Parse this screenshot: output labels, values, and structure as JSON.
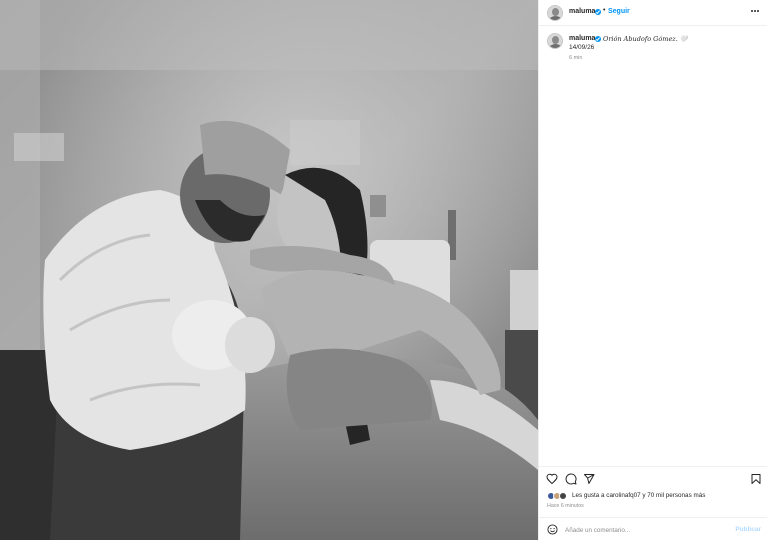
{
  "post": {
    "username": "maluma",
    "follow_label": "Seguir",
    "separator": "•",
    "photo_alt": "Foto en blanco y negro",
    "caption": {
      "username": "maluma",
      "text": "Orión Abudofo Gómez. 🤍",
      "date": "14/09/26",
      "time_ago": "6 min"
    },
    "likes": {
      "text": "Les gusta a carolinafq07 y 70 mil personas más",
      "avatar_colors": [
        "#3b5998",
        "#c8a27a",
        "#444444"
      ]
    },
    "posted": "Hace 6 minutos",
    "comment": {
      "placeholder": "Añade un comentario...",
      "value": "",
      "publish_label": "Publicar"
    }
  },
  "colors": {
    "accent": "#0095f6",
    "verified": "#0095f6",
    "publish_disabled": "#b3dbff",
    "secondary_text": "#8e8e8e"
  },
  "icons": {
    "like": "heart-icon",
    "comment": "comment-icon",
    "share": "send-icon",
    "save": "bookmark-icon",
    "more": "more-options-icon",
    "emoji": "emoji-icon"
  }
}
